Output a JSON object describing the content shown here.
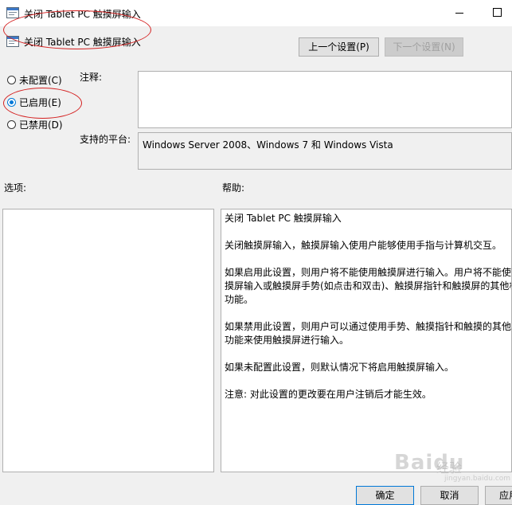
{
  "window": {
    "title": "关闭 Tablet PC 触摸屏输入",
    "minimize_glyph": "",
    "maximize_glyph": ""
  },
  "header": {
    "policy_name": "关闭 Tablet PC 触摸屏输入",
    "prev_button": "上一个设置(P)",
    "next_button": "下一个设置(N)"
  },
  "state": {
    "options": [
      {
        "label": "未配置(C)",
        "checked": false
      },
      {
        "label": "已启用(E)",
        "checked": true
      },
      {
        "label": "已禁用(D)",
        "checked": false
      }
    ]
  },
  "comment": {
    "label": "注释:",
    "value": ""
  },
  "platform": {
    "label": "支持的平台:",
    "value": "Windows Server 2008、Windows 7 和 Windows Vista"
  },
  "options_pane": {
    "label": "选项:"
  },
  "help_pane": {
    "label": "帮助:",
    "paragraphs": [
      "关闭 Tablet PC 触摸屏输入",
      "关闭触摸屏输入，触摸屏输入使用户能够使用手指与计算机交互。",
      "如果启用此设置，则用户将不能使用触摸屏进行输入。用户将不能使用",
      "摸屏输入或触摸屏手势(如点击和双击)、触摸屏指针和触摸屏的其他相",
      "功能。",
      "如果禁用此设置，则用户可以通过使用手势、触摸指针和触摸的其他的",
      "功能来使用触摸屏进行输入。",
      "如果未配置此设置，则默认情况下将启用触摸屏输入。",
      "注意: 对此设置的更改要在用户注销后才能生效。"
    ]
  },
  "footer": {
    "ok": "确定",
    "cancel": "取消",
    "apply": "应用"
  },
  "watermark": {
    "brand": "Baidu",
    "cn": "经验",
    "url": "jingyan.baidu.com"
  },
  "colors": {
    "accent": "#0078d7",
    "annotation": "#d42020"
  }
}
